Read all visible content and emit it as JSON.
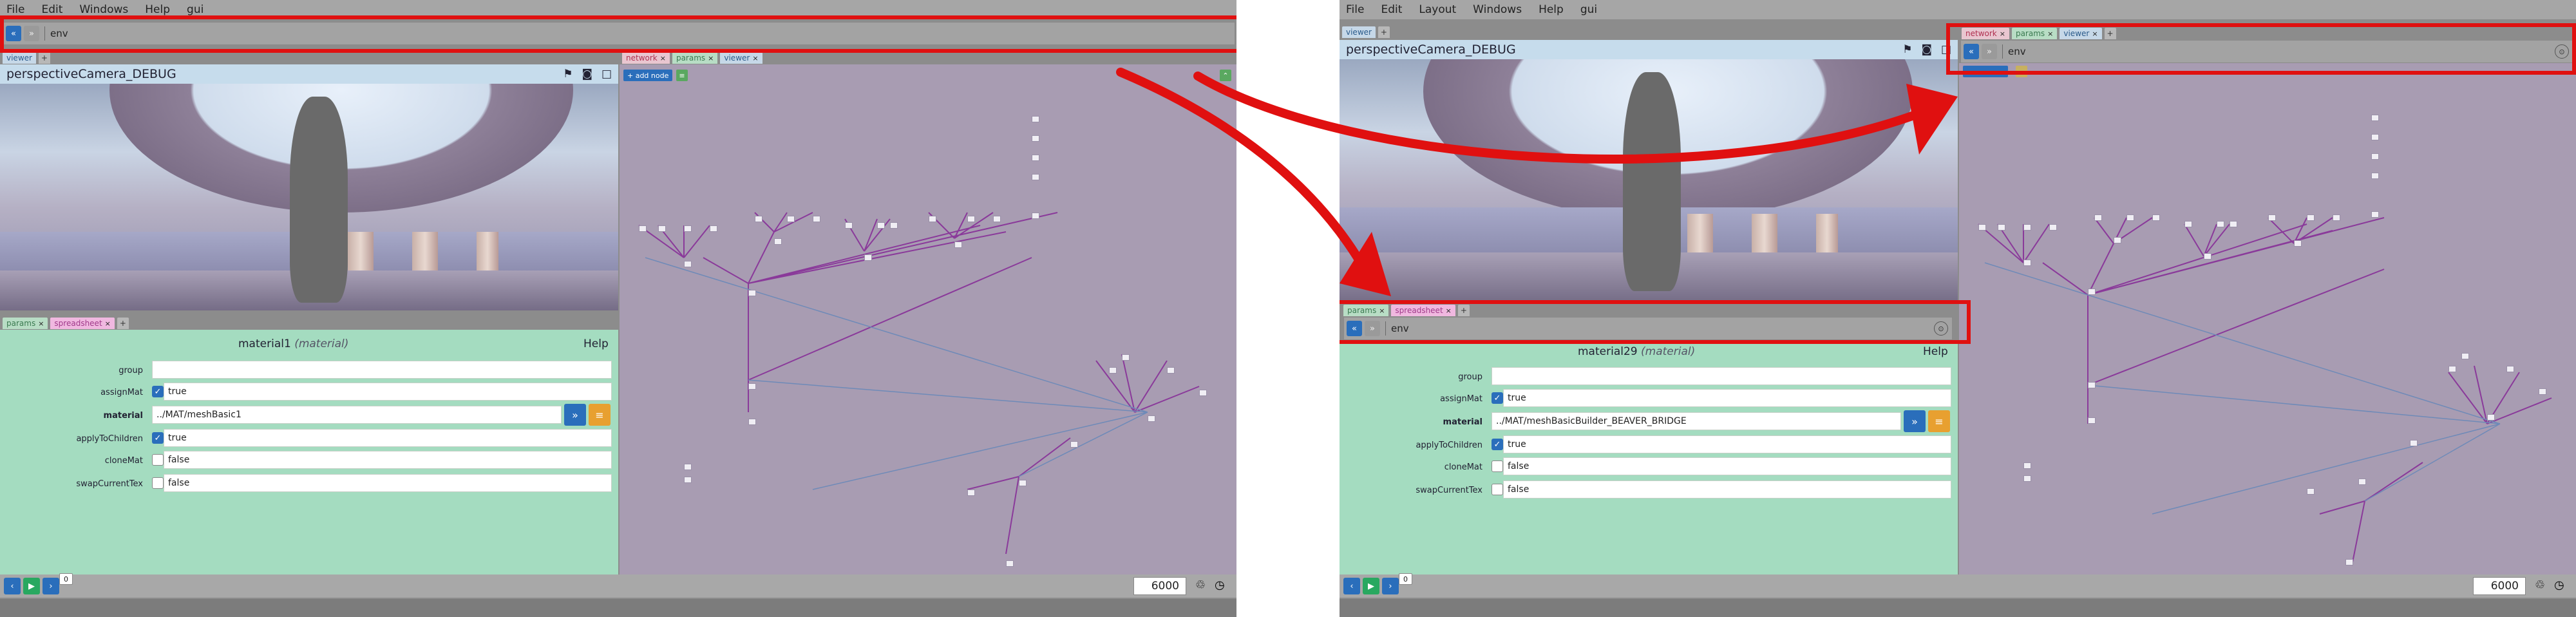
{
  "left": {
    "menu": [
      "File",
      "Edit",
      "Windows",
      "Help",
      "gui"
    ],
    "path": {
      "value": "env"
    },
    "viewer_tab": "viewer",
    "camera_title": "perspectiveCamera_DEBUG",
    "network_tabs": [
      "network",
      "params",
      "viewer"
    ],
    "add_node": "+ add node",
    "param_tabs": [
      "params",
      "spreadsheet"
    ],
    "node_title": "material1",
    "node_type": "(material)",
    "help": "Help",
    "params": [
      {
        "label": "group",
        "value": ""
      },
      {
        "label": "assignMat",
        "value": "true",
        "check": true
      },
      {
        "label": "material",
        "value": "../MAT/meshBasic1"
      },
      {
        "label": "applyToChildren",
        "value": "true",
        "check": true
      },
      {
        "label": "cloneMat",
        "value": "false",
        "check": false
      },
      {
        "label": "swapCurrentTex",
        "value": "false",
        "check": false
      }
    ],
    "frame": "6000",
    "frame_chip": "0"
  },
  "right": {
    "menu": [
      "File",
      "Edit",
      "Layout",
      "Windows",
      "Help",
      "gui"
    ],
    "viewer_tab": "viewer",
    "network_tabs": [
      "network",
      "params",
      "viewer"
    ],
    "path_top": {
      "value": "env"
    },
    "camera_title": "perspectiveCamera_DEBUG",
    "param_tabs": [
      "params",
      "spreadsheet"
    ],
    "path_params": {
      "value": "env"
    },
    "node_title": "material29",
    "node_type": "(material)",
    "help": "Help",
    "params": [
      {
        "label": "group",
        "value": ""
      },
      {
        "label": "assignMat",
        "value": "true",
        "check": true
      },
      {
        "label": "material",
        "value": "../MAT/meshBasicBuilder_BEAVER_BRIDGE"
      },
      {
        "label": "applyToChildren",
        "value": "true",
        "check": true
      },
      {
        "label": "cloneMat",
        "value": "false",
        "check": false
      },
      {
        "label": "swapCurrentTex",
        "value": "false",
        "check": false
      }
    ],
    "frame": "6000",
    "frame_chip": "0"
  },
  "colors": {
    "highlight": "#e01010",
    "accent": "#2a6ebb",
    "params_bg": "#a4dcc0",
    "network_bg": "#a89cb2"
  }
}
